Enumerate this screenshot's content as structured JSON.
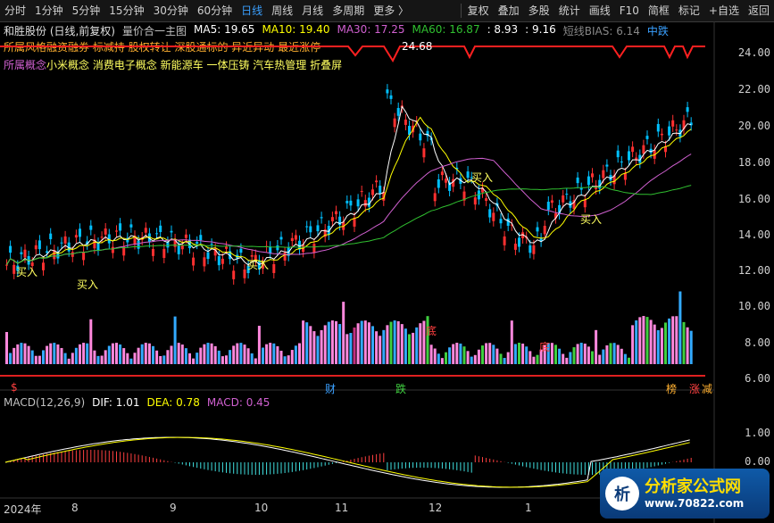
{
  "toolbar": {
    "periods": [
      "分时",
      "1分钟",
      "5分钟",
      "15分钟",
      "30分钟",
      "60分钟",
      "日线",
      "周线",
      "月线",
      "多周期",
      "更多 〉"
    ],
    "active_period": "日线",
    "right": [
      "复权",
      "叠加",
      "多股",
      "统计",
      "画线",
      "F10",
      "简框",
      "标记",
      "+自选",
      "返回"
    ]
  },
  "info": {
    "stock": "和胜股份 (日线,前复权)",
    "indicator": "量价合一主图",
    "ma5": "MA5: 19.65",
    "ma10": "MA10: 19.40",
    "ma30": "MA30: 17.25",
    "ma60": "MA60: 16.87",
    "v1": ": 8.93",
    "v2": ": 9.16",
    "bias": "短线BIAS: 6.14",
    "bias_state": "中跌"
  },
  "concepts": {
    "line1": "所属风格融资融券 标减持 股权转让 深股通标的 异近异动 最近涨停",
    "line2_label": "所属概念",
    "line2": "小米概念 消费电子概念 新能源车 一体压铸 汽车热管理 折叠屏"
  },
  "price_axis": [
    "24.00",
    "22.00",
    "20.00",
    "18.00",
    "16.00",
    "14.00",
    "12.00",
    "10.00",
    "8.00",
    "6.00"
  ],
  "macd_axis": [
    "1.00",
    "0.00"
  ],
  "macd": {
    "label": "MACD(12,26,9)",
    "dif": "DIF: 1.01",
    "dea": "DEA: 0.78",
    "val": "MACD: 0.45"
  },
  "time_axis": [
    "2024年",
    "8",
    "9",
    "10",
    "11",
    "12",
    "1"
  ],
  "annotations": {
    "peak": "24.68",
    "buy": "买入",
    "bottom": "底",
    "events": [
      "财",
      "跌",
      "榜",
      "涨",
      "减"
    ],
    "dollar": "$"
  },
  "watermark": {
    "title": "分析家公式网",
    "url": "www.70822.com",
    "logo": "析"
  },
  "colors": {
    "up": "#ff3030",
    "down": "#00c0ff",
    "ma5": "#ffffff",
    "ma10": "#ffff00",
    "ma30": "#d060d0",
    "ma60": "#30c030",
    "vol_pink": "#ff88dd",
    "vol_blue": "#33aaff",
    "vol_green": "#40d040",
    "vol_purple": "#c03080"
  }
}
